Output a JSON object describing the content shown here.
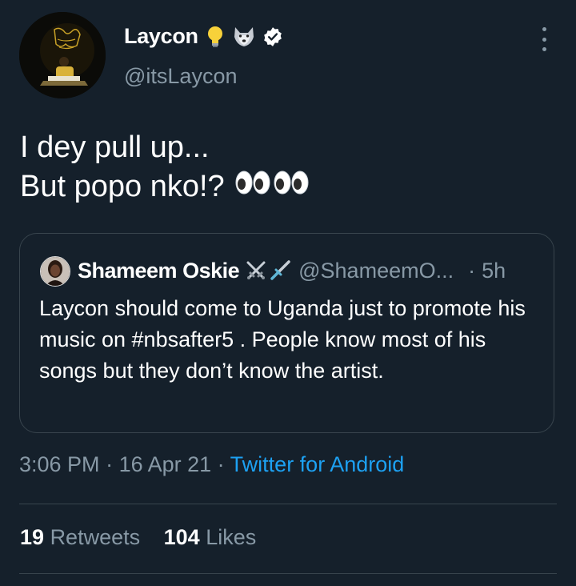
{
  "author": {
    "display_name": "Laycon",
    "handle": "@itsLaycon",
    "badges": [
      "lightbulb-emoji",
      "wolf-emoji",
      "verified-badge-icon"
    ]
  },
  "tweet": {
    "line1": "I dey pull up...",
    "line2": "But popo nko!?",
    "emojis": [
      "eyes-emoji",
      "eyes-emoji"
    ]
  },
  "quoted": {
    "display_name": "Shameem Oskie",
    "badges": [
      "crossed-swords-emoji",
      "dagger-emoji"
    ],
    "handle": "@ShameemO...",
    "separator": "·",
    "time": "5h",
    "text": "Laycon should come to Uganda just to promote his music on  #nbsafter5 . People know most of his songs but they don’t know the artist."
  },
  "meta": {
    "time": "3:06 PM",
    "sep1": " · ",
    "date": "16 Apr 21",
    "sep2": " · ",
    "source": "Twitter for Android"
  },
  "stats": {
    "retweets_count": "19",
    "retweets_label": "Retweets",
    "likes_count": "104",
    "likes_label": "Likes"
  },
  "colors": {
    "background": "#15202b",
    "secondary_text": "#8899a6",
    "link": "#1da1f2",
    "border": "#38444d",
    "verified": "#ffffff"
  }
}
